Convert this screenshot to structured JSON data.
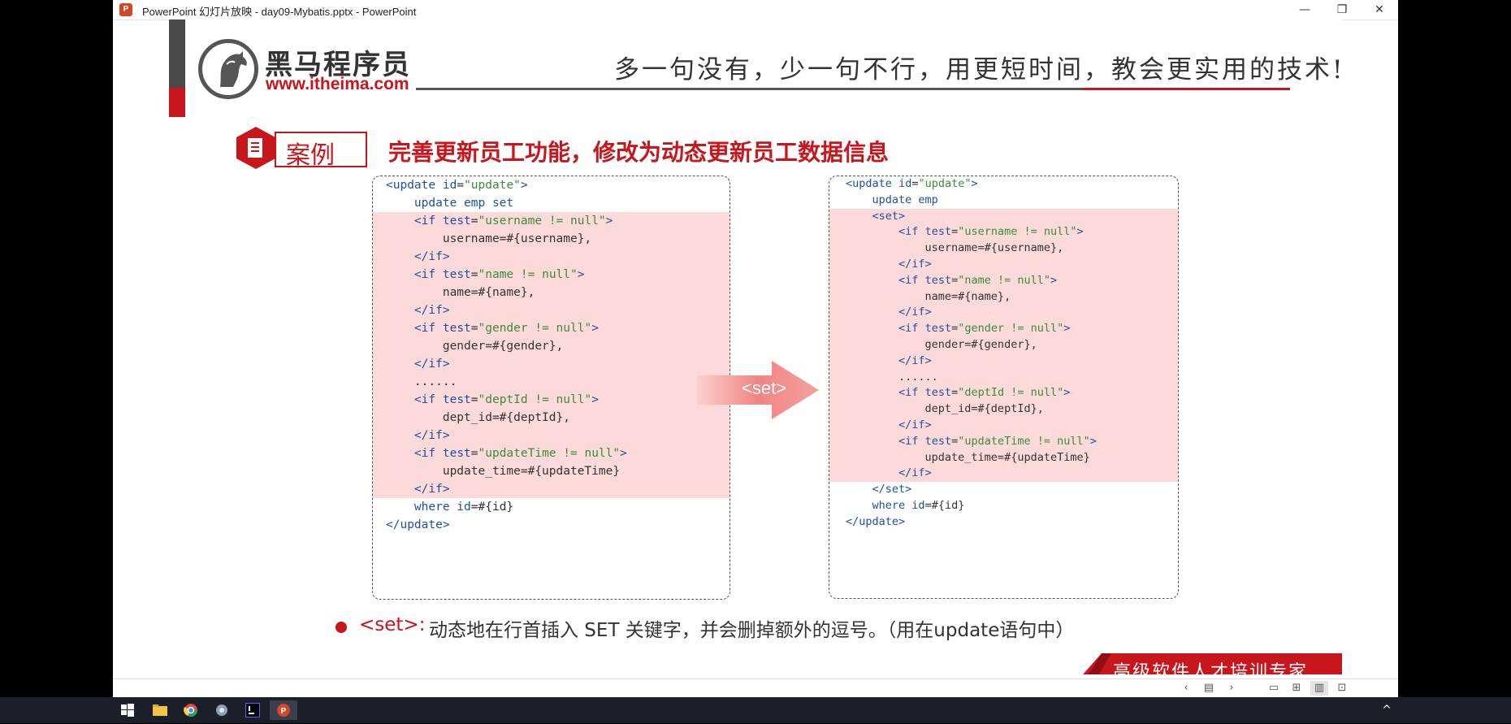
{
  "window": {
    "title": "PowerPoint 幻灯片放映  -  day09-Mybatis.pptx  -  PowerPoint",
    "app_icon_letter": "P",
    "controls": {
      "minimize": "—",
      "restore": "❐",
      "close": "✕"
    }
  },
  "slide": {
    "logo_text": "黑马程序员",
    "logo_url": "www.itheima.com",
    "slogan": "多一句没有，少一句不行，用更短时间，教会更实用的技术!",
    "case_label": "案例",
    "section_title": "完善更新员工功能，修改为动态更新员工数据信息",
    "arrow_label": "<set>",
    "bullet_tag": "<set>:",
    "bullet_text": "动态地在行首插入 SET 关键字，并会删掉额外的逗号。（用在update语句中）",
    "footer": "高级软件人才培训专家",
    "code_left": [
      "<update id=\"update\">",
      "    update emp set",
      "    <if test=\"username != null\">",
      "        username=#{username},",
      "    </if>",
      "    <if test=\"name != null\">",
      "        name=#{name},",
      "    </if>",
      "    <if test=\"gender != null\">",
      "        gender=#{gender},",
      "    </if>",
      "    ......",
      "    <if test=\"deptId != null\">",
      "        dept_id=#{deptId},",
      "    </if>",
      "    <if test=\"updateTime != null\">",
      "        update_time=#{updateTime}",
      "    </if>",
      "    where id=#{id}",
      "</update>"
    ],
    "code_right": [
      "<update id=\"update\">",
      "    update emp",
      "    <set>",
      "        <if test=\"username != null\">",
      "            username=#{username},",
      "        </if>",
      "        <if test=\"name != null\">",
      "            name=#{name},",
      "        </if>",
      "        <if test=\"gender != null\">",
      "            gender=#{gender},",
      "        </if>",
      "        ......",
      "        <if test=\"deptId != null\">",
      "            dept_id=#{deptId},",
      "        </if>",
      "        <if test=\"updateTime != null\">",
      "            update_time=#{updateTime}",
      "        </if>",
      "    </set>",
      "    where id=#{id}",
      "</update>"
    ]
  },
  "colors": {
    "accent": "#c8161d",
    "keyword": "#1f4fa3",
    "string": "#3c8b3c",
    "highlight": "#fddada"
  },
  "statusbar_icons": [
    "prev-icon",
    "slide-menu-icon",
    "next-icon",
    "normal-view-icon",
    "sorter-view-icon",
    "reading-view-icon",
    "slideshow-icon"
  ],
  "taskbar_icons": [
    "windows-start-icon",
    "file-explorer-icon",
    "chrome-icon",
    "app-icon",
    "intellij-icon",
    "powerpoint-icon"
  ]
}
